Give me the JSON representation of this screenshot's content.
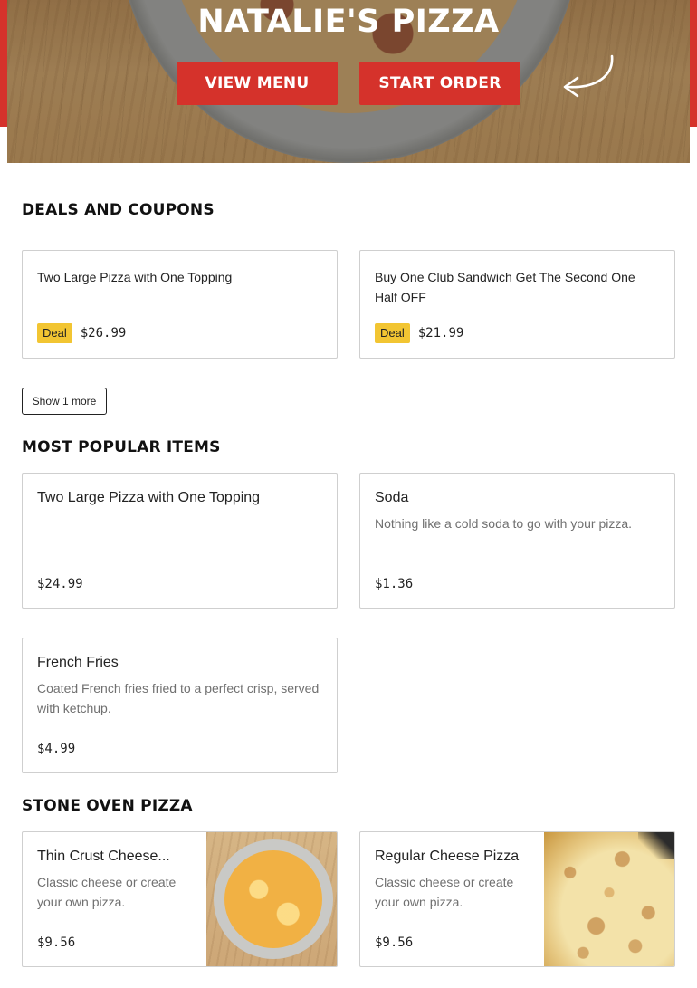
{
  "hero": {
    "title": "NATALIE'S PIZZA",
    "view_menu_label": "VIEW MENU",
    "start_order_label": "START ORDER",
    "arrow_icon": "curved-arrow-icon"
  },
  "colors": {
    "brand_red": "#d5322b",
    "deal_badge": "#f2c532"
  },
  "deals": {
    "title": "DEALS AND COUPONS",
    "items": [
      {
        "name": "Two Large Pizza with One Topping",
        "badge": "Deal",
        "price": "$26.99"
      },
      {
        "name": "Buy One Club Sandwich Get The Second One Half OFF",
        "badge": "Deal",
        "price": "$21.99"
      }
    ],
    "show_more_label": "Show 1 more"
  },
  "popular": {
    "title": "MOST POPULAR ITEMS",
    "items": [
      {
        "name": "Two Large Pizza with One Topping",
        "description": "",
        "price": "$24.99"
      },
      {
        "name": "Soda",
        "description": "Nothing like a cold soda to go with your pizza.",
        "price": "$1.36"
      },
      {
        "name": "French Fries",
        "description": "Coated French fries fried to a perfect crisp, served with ketchup.",
        "price": "$4.99"
      }
    ]
  },
  "stone_oven": {
    "title": "STONE OVEN PIZZA",
    "items": [
      {
        "name": "Thin Crust Cheese...",
        "description": "Classic cheese or create your own pizza.",
        "price": "$9.56"
      },
      {
        "name": "Regular Cheese Pizza",
        "description": "Classic cheese or create your own pizza.",
        "price": "$9.56"
      }
    ]
  }
}
